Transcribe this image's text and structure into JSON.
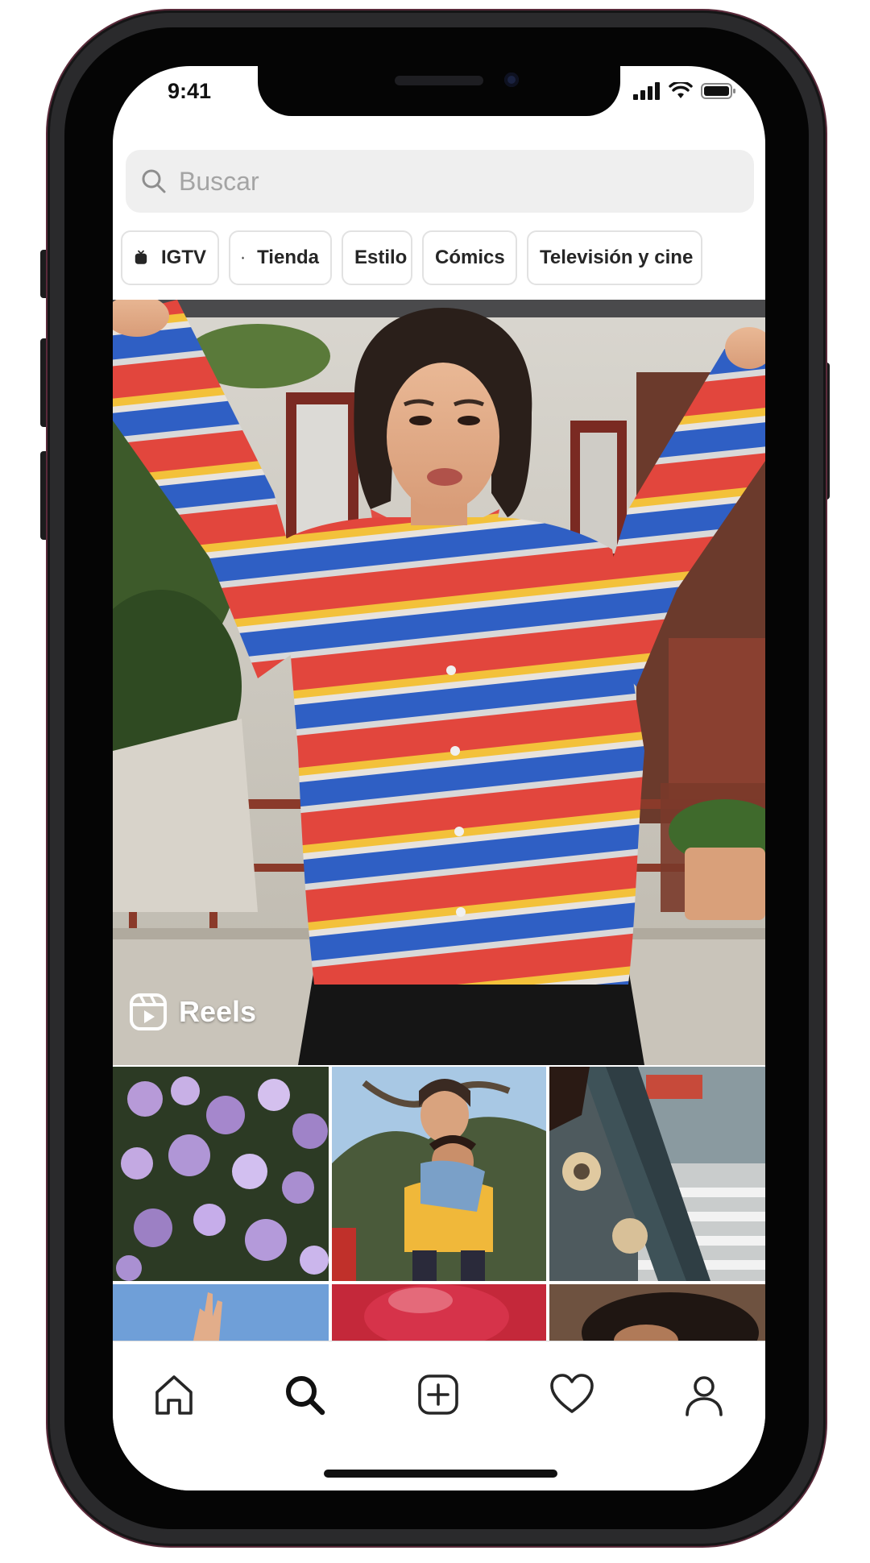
{
  "status_bar": {
    "time": "9:41"
  },
  "search": {
    "placeholder": "Buscar",
    "icon": "search-icon"
  },
  "chips": [
    {
      "label": "IGTV",
      "icon": "igtv-icon"
    },
    {
      "label": "Tienda",
      "icon": "shopping-bag-icon"
    },
    {
      "label": "Estilo",
      "icon": ""
    },
    {
      "label": "Cómics",
      "icon": ""
    },
    {
      "label": "Televisión y cine",
      "icon": ""
    }
  ],
  "hero": {
    "label": "Reels",
    "icon": "reels-icon"
  },
  "bottom_nav": {
    "items": [
      {
        "name": "home",
        "icon": "home-icon"
      },
      {
        "name": "search",
        "icon": "search-icon",
        "active": true
      },
      {
        "name": "create",
        "icon": "plus-square-icon"
      },
      {
        "name": "activity",
        "icon": "heart-icon"
      },
      {
        "name": "profile",
        "icon": "profile-icon"
      }
    ]
  },
  "colors": {
    "accent_text": "#262626",
    "search_bg": "#efefef",
    "chip_border": "#e2e2e2",
    "placeholder": "#a4a4a4"
  }
}
